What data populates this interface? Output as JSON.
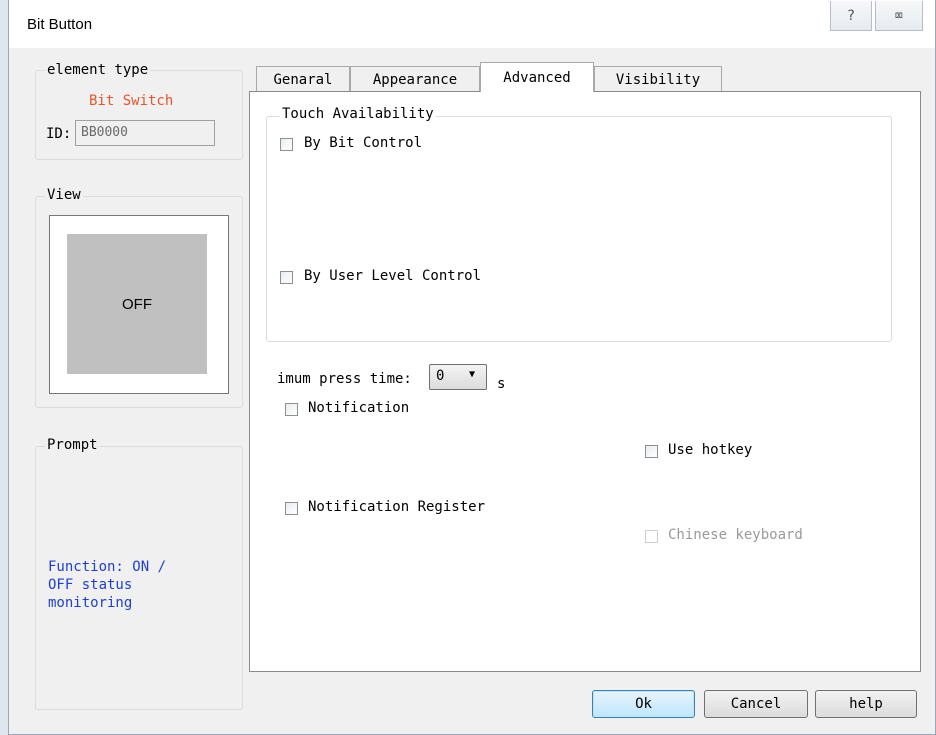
{
  "window": {
    "title": "Bit Button",
    "help_glyph": "?",
    "close_glyph": "⌧"
  },
  "element_type": {
    "group_title": "element type",
    "type_value": "Bit Switch",
    "id_label": "ID:",
    "id_value": "BB0000"
  },
  "view": {
    "group_title": "View",
    "preview_text": "OFF"
  },
  "prompt": {
    "group_title": "Prompt",
    "text": "Function: ON /\nOFF status\nmonitoring"
  },
  "tabs": [
    {
      "label": "Genaral"
    },
    {
      "label": "Appearance"
    },
    {
      "label": "Advanced"
    },
    {
      "label": "Visibility"
    }
  ],
  "active_tab": "Advanced",
  "advanced": {
    "touch_group_title": "Touch Availability",
    "by_bit_control": {
      "label": "By Bit Control",
      "checked": false
    },
    "by_user_level_control": {
      "label": "By User Level Control",
      "checked": false
    },
    "press_time_label": "imum press time:",
    "press_time_value": "0",
    "press_time_unit": "s",
    "notification": {
      "label": "Notification",
      "checked": false
    },
    "use_hotkey": {
      "label": "Use hotkey",
      "checked": false
    },
    "notification_register": {
      "label": "Notification Register",
      "checked": false
    },
    "chinese_keyboard": {
      "label": "Chinese keyboard",
      "checked": false,
      "disabled": true
    }
  },
  "buttons": {
    "ok": "Ok",
    "cancel": "Cancel",
    "help": "help"
  },
  "colors": {
    "type_value": "#e8552a",
    "prompt_text": "#1f3fd0",
    "disabled_text": "#9a9a9a",
    "preview_fill": "#c0c0c0"
  }
}
